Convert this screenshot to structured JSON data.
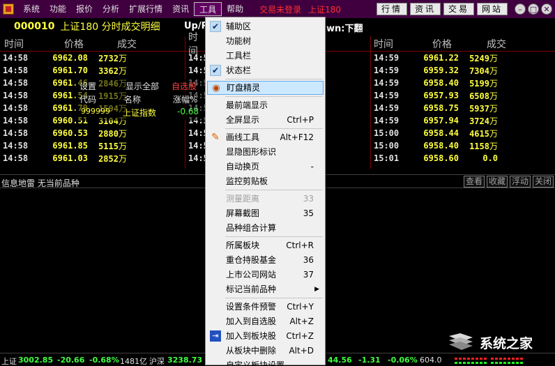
{
  "menubar": {
    "items": [
      "系统",
      "功能",
      "报价",
      "分析",
      "扩展行情",
      "资讯",
      "工具",
      "帮助"
    ],
    "status_login": "交易未登录",
    "status_index": "上证180",
    "buttons": [
      "行情",
      "资讯",
      "交易",
      "网站"
    ]
  },
  "title": {
    "code": "000010",
    "name": "上证180 分时成交明细",
    "up_text": "Up/P",
    "down_text": "wn:下翻"
  },
  "panels": {
    "headers": [
      "时间",
      "价格",
      "成交"
    ],
    "unit": "万",
    "left": [
      {
        "t": "14:58",
        "p": "6962.08",
        "v": "2732"
      },
      {
        "t": "14:58",
        "p": "6961.70",
        "v": "3362"
      },
      {
        "t": "14:58",
        "p": "6961.46",
        "v": "2846"
      },
      {
        "t": "14:58",
        "p": "6961.54",
        "v": "1915"
      },
      {
        "t": "14:58",
        "p": "6961.79",
        "v": "1594"
      },
      {
        "t": "14:58",
        "p": "6960.51",
        "v": "3104"
      },
      {
        "t": "14:58",
        "p": "6960.53",
        "v": "2880"
      },
      {
        "t": "14:58",
        "p": "6961.85",
        "v": "5115"
      },
      {
        "t": "14:58",
        "p": "6961.03",
        "v": "2852"
      }
    ],
    "middle": [
      {
        "t": "14:5"
      },
      {
        "t": "14:5"
      },
      {
        "t": "14:5"
      },
      {
        "t": "14:5"
      },
      {
        "t": "14:5"
      },
      {
        "t": "14:5"
      },
      {
        "t": "14:5"
      },
      {
        "t": "14:5"
      },
      {
        "t": "14:5"
      }
    ],
    "right": [
      {
        "t": "14:59",
        "p": "6961.22",
        "v": "5249"
      },
      {
        "t": "14:59",
        "p": "6959.32",
        "v": "7304"
      },
      {
        "t": "14:59",
        "p": "6958.40",
        "v": "5199"
      },
      {
        "t": "14:59",
        "p": "6957.93",
        "v": "6508"
      },
      {
        "t": "14:59",
        "p": "6958.75",
        "v": "5937"
      },
      {
        "t": "14:59",
        "p": "6957.94",
        "v": "3724"
      },
      {
        "t": "15:00",
        "p": "6958.44",
        "v": "4615"
      },
      {
        "t": "15:00",
        "p": "6958.40",
        "v": "1158"
      },
      {
        "t": "15:01",
        "p": "6958.60",
        "v": "0.0"
      }
    ]
  },
  "mini_window": {
    "settings": "设置",
    "show_all": "显示全部",
    "watchlist": "自选股",
    "col_code": "代码",
    "col_name": "名称",
    "col_change": "涨幅%",
    "row_code": "999999",
    "row_name": "上证指数",
    "row_change": "-0.68"
  },
  "infobar": {
    "label": "信息地雷  无当前品种",
    "buttons": [
      "查看",
      "收藏",
      "浮动",
      "关闭"
    ]
  },
  "statusbar": {
    "sh_label": "上证",
    "sh_value": "3002.85",
    "sh_change": "-20.66",
    "sh_pct": "-0.68%",
    "sh_amount": "1481亿",
    "hs_label": "沪深",
    "hs_value": "3238.73",
    "r_value": "44.56",
    "r_change": "-1.31",
    "r_pct": "-0.06%",
    "r_amount": "604.0"
  },
  "dropdown": {
    "items": [
      {
        "label": "辅助区",
        "shortcut": "",
        "icon": "check-icon"
      },
      {
        "label": "功能树",
        "shortcut": "",
        "icon": ""
      },
      {
        "label": "工具栏",
        "shortcut": "",
        "icon": ""
      },
      {
        "label": "状态栏",
        "shortcut": "",
        "icon": "check-icon"
      },
      {
        "label": "盯盘精灵",
        "shortcut": "",
        "icon": "eye-icon"
      },
      {
        "label": "最前端显示",
        "shortcut": "",
        "icon": ""
      },
      {
        "label": "全屏显示",
        "shortcut": "Ctrl+P",
        "icon": ""
      },
      {
        "label": "画线工具",
        "shortcut": "Alt+F12",
        "icon": "pen-icon"
      },
      {
        "label": "显隐图形标识",
        "shortcut": "",
        "icon": ""
      },
      {
        "label": "自动换页",
        "shortcut": "-",
        "icon": ""
      },
      {
        "label": "监控剪贴板",
        "shortcut": "",
        "icon": ""
      },
      {
        "label": "测量距离",
        "shortcut": "33",
        "icon": ""
      },
      {
        "label": "屏幕截图",
        "shortcut": "35",
        "icon": ""
      },
      {
        "label": "品种组合计算",
        "shortcut": "",
        "icon": ""
      },
      {
        "label": "所属板块",
        "shortcut": "Ctrl+R",
        "icon": ""
      },
      {
        "label": "重仓持股基金",
        "shortcut": "36",
        "icon": ""
      },
      {
        "label": "上市公司网站",
        "shortcut": "37",
        "icon": ""
      },
      {
        "label": "标记当前品种",
        "shortcut": "",
        "icon": ""
      },
      {
        "label": "设置条件预警",
        "shortcut": "Ctrl+Y",
        "icon": ""
      },
      {
        "label": "加入到自选股",
        "shortcut": "Alt+Z",
        "icon": ""
      },
      {
        "label": "加入到板块股",
        "shortcut": "Ctrl+Z",
        "icon": "add-icon"
      },
      {
        "label": "从板块中删除",
        "shortcut": "Alt+D",
        "icon": ""
      },
      {
        "label": "自定义板块设置",
        "shortcut": "",
        "icon": ""
      }
    ]
  },
  "watermark": {
    "text": "系统之家"
  }
}
